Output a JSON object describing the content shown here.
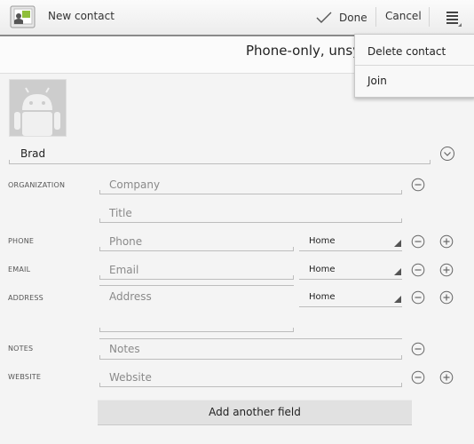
{
  "actionbar": {
    "title": "New contact",
    "done_label": "Done",
    "cancel_label": "Cancel"
  },
  "account": {
    "label": "Phone-only, unsy"
  },
  "menu": {
    "items": [
      {
        "label": "Delete contact"
      },
      {
        "label": "Join"
      }
    ]
  },
  "name": {
    "value": "Brad"
  },
  "sections": {
    "organization": "ORGANIZATION",
    "phone": "PHONE",
    "email": "EMAIL",
    "address": "ADDRESS",
    "notes": "NOTES",
    "website": "WEBSITE"
  },
  "fields": {
    "company_placeholder": "Company",
    "title_placeholder": "Title",
    "phone_placeholder": "Phone",
    "email_placeholder": "Email",
    "address_placeholder": "Address",
    "notes_placeholder": "Notes",
    "website_placeholder": "Website"
  },
  "types": {
    "phone": "Home",
    "email": "Home",
    "address": "Home"
  },
  "add_field_label": "Add another field",
  "colors": {
    "background": "#f4f4f4",
    "actionbar_border": "#8a8a8a",
    "placeholder_text": "#8a8a8a",
    "button_bg": "#e1e1e1"
  },
  "icons": {
    "app": "contacts-app-icon",
    "done": "checkmark-icon",
    "overflow": "overflow-menu-icon",
    "expand": "chevron-down-circle-icon",
    "remove": "minus-circle-icon",
    "add": "plus-circle-icon",
    "photo": "android-robot-icon"
  }
}
